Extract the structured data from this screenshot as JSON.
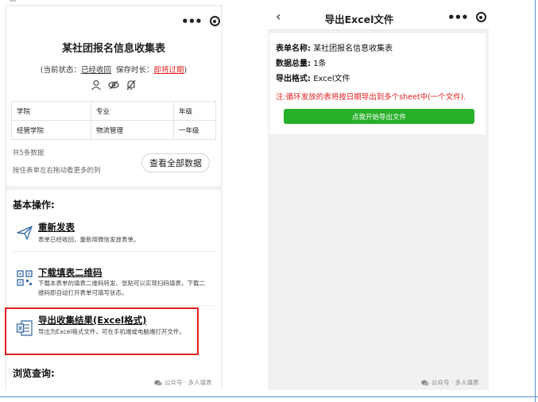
{
  "left_screen": {
    "form_title": "某社团报名信息收集表",
    "status": {
      "open": "(当前状态：",
      "state_value": "已经收回",
      "keep_label": "保存时长：",
      "keep_value": "即将过期",
      "close": ")"
    },
    "table": {
      "headers": [
        "学院",
        "专业",
        "年级"
      ],
      "rows": [
        [
          "经管学院",
          "物流管理",
          "一年级"
        ]
      ]
    },
    "data_count": "共5条数据",
    "scroll_hint": "按住表单左右拖动看更多的列",
    "view_all_label": "查看全部数据",
    "basic_ops_title": "基本操作:",
    "operations": [
      {
        "title": "重新发表",
        "desc": "表单已经收回，重新用微信发放表单。",
        "icon": "paper-plane-icon"
      },
      {
        "title": "下载填表二维码",
        "desc": "下载本表单的填表二维码转发、张贴可以实现扫码填表，下载二维码即自动打开表单可填写状态。",
        "icon": "qr-code-icon"
      },
      {
        "title": "导出收集结果(Excel格式)",
        "desc": "导出为Excel格式文件，可在手机端或电脑端打开文件。",
        "icon": "excel-file-icon"
      }
    ],
    "browse_title": "浏览查询:",
    "watermark": "公众号 · 多人填表"
  },
  "right_screen": {
    "nav_title": "导出Excel文件",
    "rows": [
      {
        "label": "表单名称:",
        "value": "某社团报名信息收集表"
      },
      {
        "label": "数据总量:",
        "value": "1条"
      },
      {
        "label": "导出格式:",
        "value": "Excel文件"
      }
    ],
    "notice": "注:循环发放的表将按日期导出到多个sheet中(一个文件).",
    "export_button_label": "点我开始导出文件",
    "watermark": "公众号 · 多人填表"
  },
  "colors": {
    "accent_green": "#27b12a",
    "alert_red": "#e02020",
    "highlight_box": "#e02020"
  }
}
